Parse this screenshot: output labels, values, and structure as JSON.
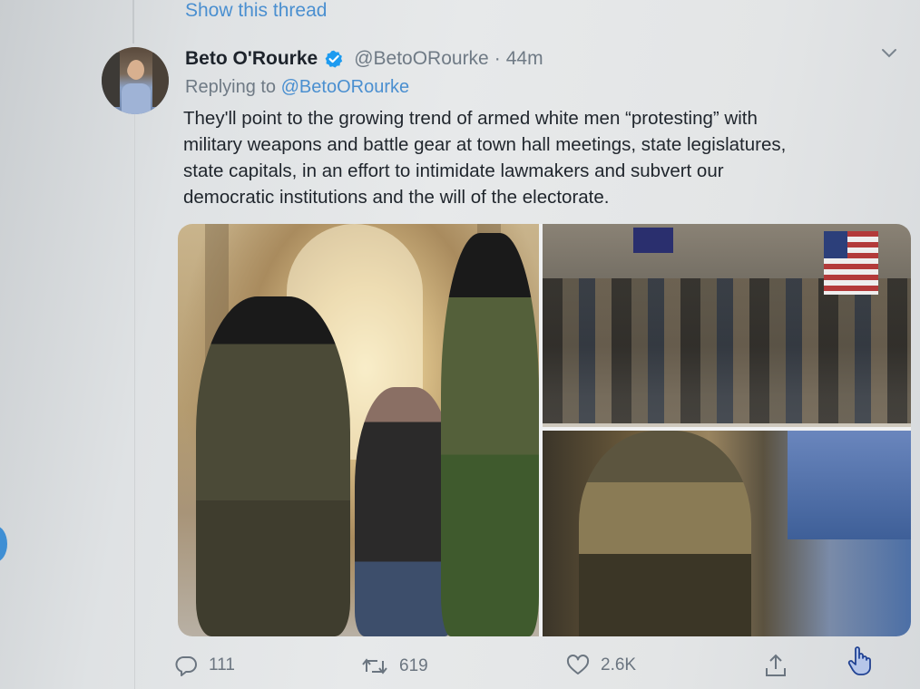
{
  "thread": {
    "show_thread_label": "Show this thread"
  },
  "tweet": {
    "author_name": "Beto O'Rourke",
    "verified": true,
    "handle": "@BetoORourke",
    "separator": "·",
    "time": "44m",
    "replying_to_prefix": "Replying to",
    "replying_to_handle": "@BetoORourke",
    "text_lines": [
      "They'll point to the growing trend of armed white men “protesting” with",
      "military weapons and battle gear at town hall meetings, state legislatures,",
      "state capitals, in an effort to intimidate lawmakers and subvert our",
      "democratic institutions and the will of the electorate."
    ],
    "media_count": 3
  },
  "actions": {
    "reply": {
      "icon": "reply-icon",
      "count": "111"
    },
    "retweet": {
      "icon": "retweet-icon",
      "count": "619"
    },
    "like": {
      "icon": "heart-icon",
      "count": "2.6K"
    },
    "share": {
      "icon": "share-icon"
    }
  },
  "colors": {
    "link": "#4a8fd0",
    "verified": "#1d9bf0",
    "text": "#1f252c",
    "muted": "#6f7a85"
  }
}
